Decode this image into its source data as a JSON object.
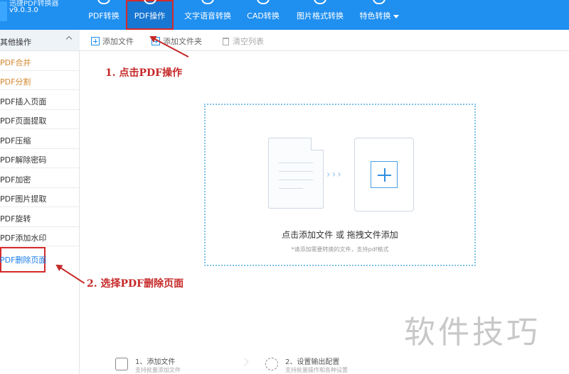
{
  "app": {
    "name": "迅捷PDF转换器",
    "version": "v9.0.3.0"
  },
  "nav": {
    "tabs": [
      {
        "label": "PDF转换",
        "icon": "chat-bubble-icon"
      },
      {
        "label": "PDF操作",
        "icon": "chat-bubble-icon",
        "active": true
      },
      {
        "label": "文字语音转换",
        "icon": "speech-icon"
      },
      {
        "label": "CAD转换",
        "icon": "cad-icon"
      },
      {
        "label": "图片格式转换",
        "icon": "image-icon"
      },
      {
        "label": "特色转换",
        "icon": "star-icon"
      }
    ]
  },
  "sidebar": {
    "header": "其他操作",
    "items": [
      {
        "label": "PDF合并"
      },
      {
        "label": "PDF分割"
      },
      {
        "label": "PDF插入页面"
      },
      {
        "label": "PDF页面提取"
      },
      {
        "label": "PDF压缩"
      },
      {
        "label": "PDF解除密码"
      },
      {
        "label": "PDF加密"
      },
      {
        "label": "PDF图片提取"
      },
      {
        "label": "PDF旋转"
      },
      {
        "label": "PDF添加水印"
      },
      {
        "label": "PDF删除页面",
        "selected": true
      }
    ]
  },
  "toolbar": {
    "add_file": "添加文件",
    "add_folder": "添加文件夹",
    "clear_list": "清空列表"
  },
  "dropzone": {
    "title": "点击添加文件 或 拖拽文件添加",
    "hint": "*请添加需要转换的文件，支持pdf格式",
    "arrows": "›››"
  },
  "annotations": {
    "step1": "1. 点击PDF操作",
    "step2": "2. 选择PDF删除页面"
  },
  "steps": [
    {
      "title": "1、添加文件",
      "subtitle": "支持批量添加文件"
    },
    {
      "title": "2、设置输出配置",
      "subtitle": "支持批量操作和各种设置"
    }
  ],
  "watermark": "软件技巧",
  "colors": {
    "topbar": "#1f8ff0",
    "accent": "#1a7fe8",
    "annotation": "#c62828",
    "orange_item": "#d4862b"
  }
}
